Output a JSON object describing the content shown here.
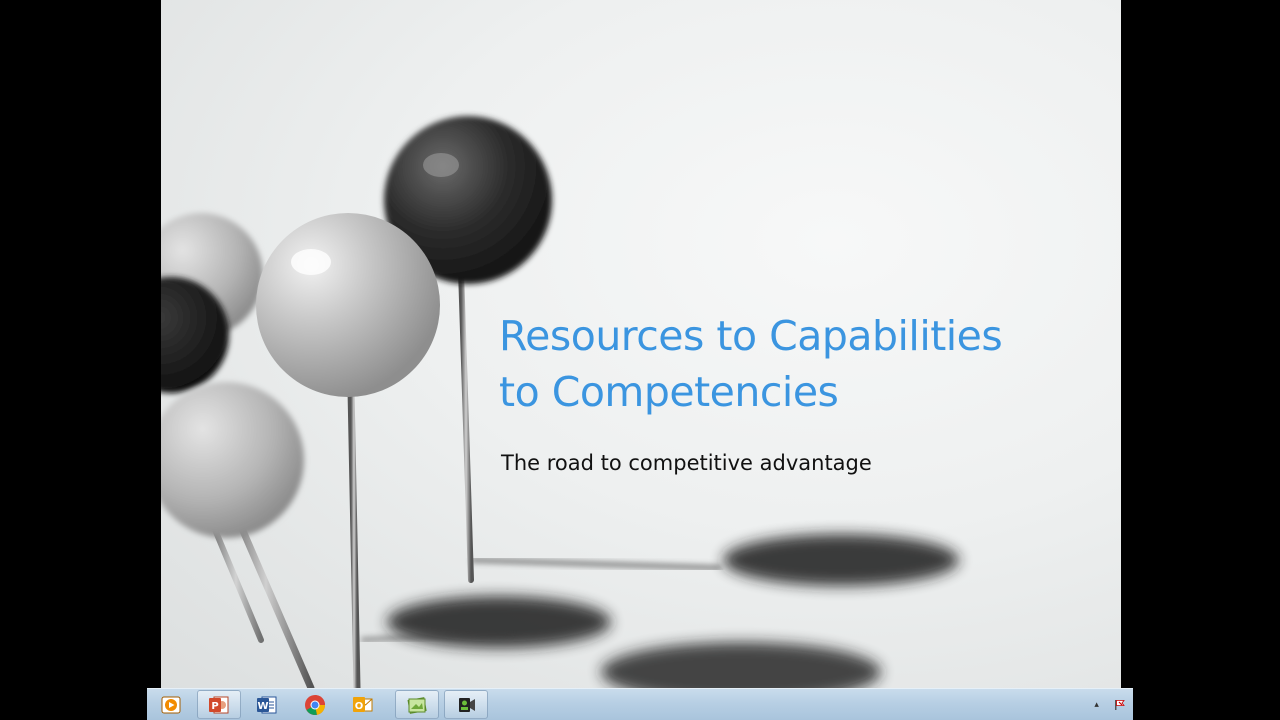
{
  "slide": {
    "title_line1": "Resources to Capabilities",
    "title_line2": "to Competencies",
    "subtitle": "The road to competitive advantage",
    "title_color": "#3b95e0"
  },
  "taskbar": {
    "buttons": [
      {
        "name": "media-player-icon",
        "open": false
      },
      {
        "name": "powerpoint-icon",
        "open": true
      },
      {
        "name": "word-icon",
        "open": false
      },
      {
        "name": "chrome-icon",
        "open": false
      },
      {
        "name": "outlook-icon",
        "open": false
      },
      {
        "name": "slideshow-icon",
        "open": true
      },
      {
        "name": "camtasia-recorder-icon",
        "open": true
      }
    ],
    "tray": {
      "show_hidden_icon": "chevron-up-icon",
      "flag_icon": "action-center-flag-icon"
    },
    "colors": {
      "background": "#b7cfe4"
    }
  }
}
